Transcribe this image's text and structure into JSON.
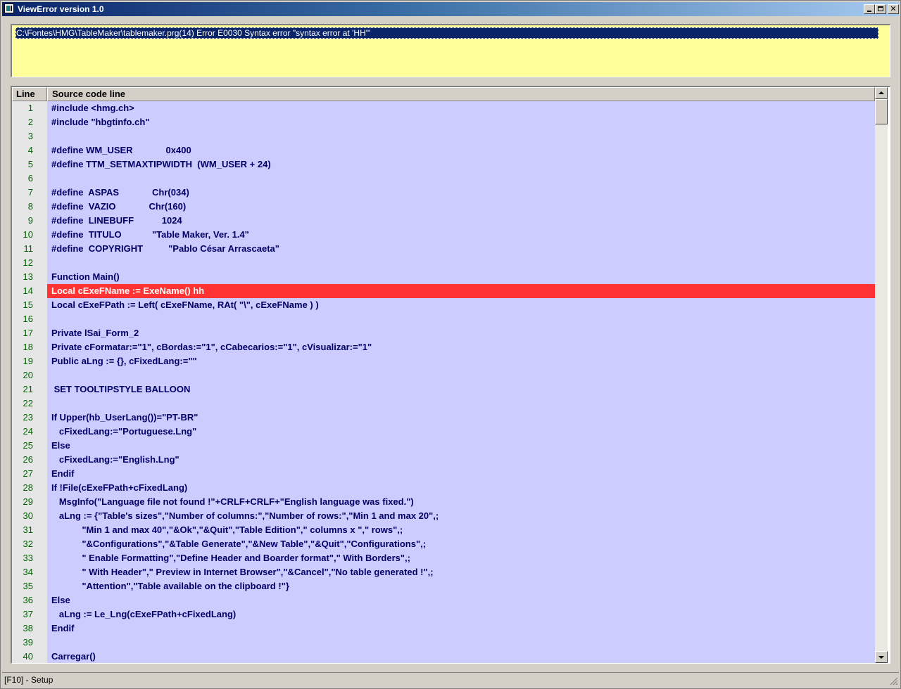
{
  "window": {
    "title": "ViewError version 1.0",
    "minimize_glyph": "",
    "maximize_glyph": "",
    "close_glyph": "✕"
  },
  "error": {
    "message": "C:\\Fontes\\HMG\\TableMaker\\tablemaker.prg(14) Error E0030  Syntax error \"syntax error at 'HH'\""
  },
  "grid": {
    "columns": [
      "Line",
      "Source code line"
    ],
    "error_line": 14,
    "rows": [
      {
        "line": "1",
        "code": "#include <hmg.ch>"
      },
      {
        "line": "2",
        "code": "#include \"hbgtinfo.ch\""
      },
      {
        "line": "3",
        "code": ""
      },
      {
        "line": "4",
        "code": "#define WM_USER             0x400"
      },
      {
        "line": "5",
        "code": "#define TTM_SETMAXTIPWIDTH  (WM_USER + 24)"
      },
      {
        "line": "6",
        "code": ""
      },
      {
        "line": "7",
        "code": "#define  ASPAS             Chr(034)"
      },
      {
        "line": "8",
        "code": "#define  VAZIO             Chr(160)"
      },
      {
        "line": "9",
        "code": "#define  LINEBUFF           1024"
      },
      {
        "line": "10",
        "code": "#define  TITULO            \"Table Maker, Ver. 1.4\""
      },
      {
        "line": "11",
        "code": "#define  COPYRIGHT          \"Pablo César Arrascaeta\""
      },
      {
        "line": "12",
        "code": ""
      },
      {
        "line": "13",
        "code": "Function Main()"
      },
      {
        "line": "14",
        "code": "Local cExeFName := ExeName() hh"
      },
      {
        "line": "15",
        "code": "Local cExeFPath := Left( cExeFName, RAt( \"\\\", cExeFName ) )"
      },
      {
        "line": "16",
        "code": ""
      },
      {
        "line": "17",
        "code": "Private lSai_Form_2"
      },
      {
        "line": "18",
        "code": "Private cFormatar:=\"1\", cBordas:=\"1\", cCabecarios:=\"1\", cVisualizar:=\"1\""
      },
      {
        "line": "19",
        "code": "Public aLng := {}, cFixedLang:=\"\""
      },
      {
        "line": "20",
        "code": ""
      },
      {
        "line": "21",
        "code": " SET TOOLTIPSTYLE BALLOON"
      },
      {
        "line": "22",
        "code": ""
      },
      {
        "line": "23",
        "code": "If Upper(hb_UserLang())=\"PT-BR\""
      },
      {
        "line": "24",
        "code": "   cFixedLang:=\"Portuguese.Lng\""
      },
      {
        "line": "25",
        "code": "Else"
      },
      {
        "line": "26",
        "code": "   cFixedLang:=\"English.Lng\""
      },
      {
        "line": "27",
        "code": "Endif"
      },
      {
        "line": "28",
        "code": "If !File(cExeFPath+cFixedLang)"
      },
      {
        "line": "29",
        "code": "   MsgInfo(\"Language file not found !\"+CRLF+CRLF+\"English language was fixed.\")"
      },
      {
        "line": "30",
        "code": "   aLng := {\"Table's sizes\",\"Number of columns:\",\"Number of rows:\",\"Min 1 and max 20\",;"
      },
      {
        "line": "31",
        "code": "            \"Min 1 and max 40\",\"&Ok\",\"&Quit\",\"Table Edition\",\" columns x \",\" rows\",;"
      },
      {
        "line": "32",
        "code": "            \"&Configurations\",\"&Table Generate\",\"&New Table\",\"&Quit\",\"Configurations\",;"
      },
      {
        "line": "33",
        "code": "            \" Enable Formatting\",\"Define Header and Boarder format\",\" With Borders\",;"
      },
      {
        "line": "34",
        "code": "            \" With Header\",\" Preview in Internet Browser\",\"&Cancel\",\"No table generated !\",;"
      },
      {
        "line": "35",
        "code": "            \"Attention\",\"Table available on the clipboard !\"}"
      },
      {
        "line": "36",
        "code": "Else"
      },
      {
        "line": "37",
        "code": "   aLng := Le_Lng(cExeFPath+cFixedLang)"
      },
      {
        "line": "38",
        "code": "Endif"
      },
      {
        "line": "39",
        "code": ""
      },
      {
        "line": "40",
        "code": "Carregar()"
      }
    ]
  },
  "status": {
    "text": "[F10] - Setup"
  },
  "colors": {
    "error_panel_bg": "#ffff99",
    "selected_error_bg": "#0a246a",
    "code_bg": "#ccccff",
    "error_row_bg": "#ff3333",
    "line_number_color": "#006400",
    "code_text_color": "#000066"
  },
  "icons": {
    "app": "app-icon",
    "scroll_up": "arrow-up-icon",
    "scroll_down": "arrow-down-icon"
  }
}
